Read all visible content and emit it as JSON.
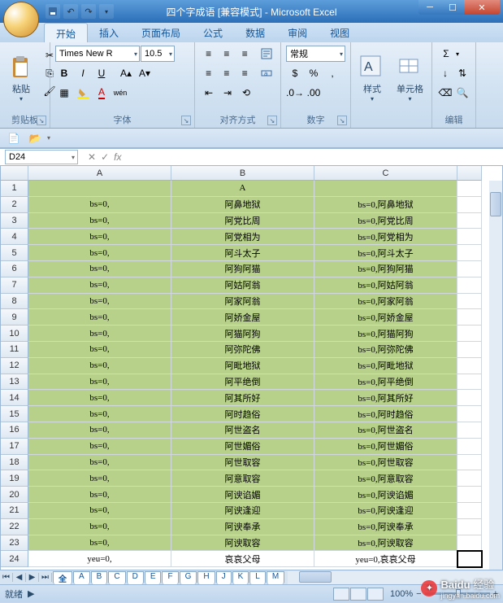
{
  "window": {
    "doc_title": "四个字成语 [兼容模式] - Microsoft Excel"
  },
  "tabs": [
    "开始",
    "插入",
    "页面布局",
    "公式",
    "数据",
    "审阅",
    "视图"
  ],
  "active_tab": "开始",
  "ribbon": {
    "clipboard": {
      "label": "剪贴板",
      "paste": "粘贴"
    },
    "font": {
      "label": "字体",
      "name": "Times New R",
      "size": "10.5"
    },
    "align": {
      "label": "对齐方式"
    },
    "number": {
      "label": "数字",
      "format": "常规"
    },
    "styles": {
      "label": " ",
      "style": "样式",
      "cell_fmt": "单元格"
    },
    "editing": {
      "label": "编辑"
    }
  },
  "name_box": "D24",
  "formula": "",
  "columns": [
    "A",
    "B",
    "C"
  ],
  "rows": [
    {
      "n": 1,
      "a": "",
      "b": "A",
      "c": ""
    },
    {
      "n": 2,
      "a": "bs=0,",
      "b": "阿鼻地狱",
      "c": "bs=0,阿鼻地狱"
    },
    {
      "n": 3,
      "a": "bs=0,",
      "b": "阿党比周",
      "c": "bs=0,阿党比周"
    },
    {
      "n": 4,
      "a": "bs=0,",
      "b": "阿党相为",
      "c": "bs=0,阿党相为"
    },
    {
      "n": 5,
      "a": "bs=0,",
      "b": "阿斗太子",
      "c": "bs=0,阿斗太子"
    },
    {
      "n": 6,
      "a": "bs=0,",
      "b": "阿狗阿猫",
      "c": "bs=0,阿狗阿猫"
    },
    {
      "n": 7,
      "a": "bs=0,",
      "b": "阿姑阿翁",
      "c": "bs=0,阿姑阿翁"
    },
    {
      "n": 8,
      "a": "bs=0,",
      "b": "阿家阿翁",
      "c": "bs=0,阿家阿翁"
    },
    {
      "n": 9,
      "a": "bs=0,",
      "b": "阿娇金屋",
      "c": "bs=0,阿娇金屋"
    },
    {
      "n": 10,
      "a": "bs=0,",
      "b": "阿猫阿狗",
      "c": "bs=0,阿猫阿狗"
    },
    {
      "n": 11,
      "a": "bs=0,",
      "b": "阿弥陀佛",
      "c": "bs=0,阿弥陀佛"
    },
    {
      "n": 12,
      "a": "bs=0,",
      "b": "阿毗地狱",
      "c": "bs=0,阿毗地狱"
    },
    {
      "n": 13,
      "a": "bs=0,",
      "b": "阿平绝倒",
      "c": "bs=0,阿平绝倒"
    },
    {
      "n": 14,
      "a": "bs=0,",
      "b": "阿其所好",
      "c": "bs=0,阿其所好"
    },
    {
      "n": 15,
      "a": "bs=0,",
      "b": "阿时趋俗",
      "c": "bs=0,阿时趋俗"
    },
    {
      "n": 16,
      "a": "bs=0,",
      "b": "阿世盗名",
      "c": "bs=0,阿世盗名"
    },
    {
      "n": 17,
      "a": "bs=0,",
      "b": "阿世媚俗",
      "c": "bs=0,阿世媚俗"
    },
    {
      "n": 18,
      "a": "bs=0,",
      "b": "阿世取容",
      "c": "bs=0,阿世取容"
    },
    {
      "n": 19,
      "a": "bs=0,",
      "b": "阿意取容",
      "c": "bs=0,阿意取容"
    },
    {
      "n": 20,
      "a": "bs=0,",
      "b": "阿谀谄媚",
      "c": "bs=0,阿谀谄媚"
    },
    {
      "n": 21,
      "a": "bs=0,",
      "b": "阿谀逢迎",
      "c": "bs=0,阿谀逢迎"
    },
    {
      "n": 22,
      "a": "bs=0,",
      "b": "阿谀奉承",
      "c": "bs=0,阿谀奉承"
    },
    {
      "n": 23,
      "a": "bs=0,",
      "b": "阿谀取容",
      "c": "bs=0,阿谀取容"
    },
    {
      "n": 24,
      "a": "yeu=0,",
      "b": "哀哀父母",
      "c": "yeu=0,哀哀父母"
    }
  ],
  "sheets": [
    "全",
    "A",
    "B",
    "C",
    "D",
    "E",
    "F",
    "G",
    "H",
    "J",
    "K",
    "L",
    "M"
  ],
  "active_sheet": "全",
  "status": {
    "ready": "就绪",
    "zoom": "100%"
  },
  "watermark": {
    "brand": "Baidu",
    "sub": "经验",
    "url": "jingyan.baidu.com"
  }
}
